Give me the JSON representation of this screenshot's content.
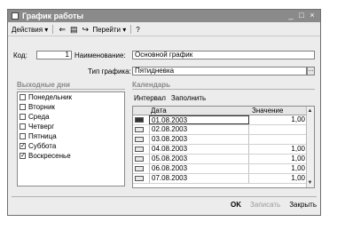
{
  "window": {
    "title": "График работы",
    "controls": [
      "_",
      "□",
      "×"
    ]
  },
  "toolbar": {
    "actions": "Действия",
    "goto": "Перейти",
    "help": "?"
  },
  "form": {
    "code_label": "Код:",
    "code_value": "1",
    "name_label": "Наименование:",
    "name_value": "Основной график",
    "type_label": "Тип графика:",
    "type_value": "Пятидневка",
    "type_button": "..."
  },
  "days": {
    "title": "Выходные дни",
    "items": [
      {
        "label": "Понедельник",
        "checked": false
      },
      {
        "label": "Вторник",
        "checked": false
      },
      {
        "label": "Среда",
        "checked": false
      },
      {
        "label": "Четверг",
        "checked": false
      },
      {
        "label": "Пятница",
        "checked": false
      },
      {
        "label": "Суббота",
        "checked": true
      },
      {
        "label": "Воскресенье",
        "checked": true
      }
    ]
  },
  "calendar": {
    "title": "Календарь",
    "interval": "Интервал",
    "fill": "Заполнить",
    "columns": {
      "date": "Дата",
      "value": "Значение"
    },
    "rows": [
      {
        "date": "01.08.2003",
        "value": "1,00"
      },
      {
        "date": "02.08.2003",
        "value": ""
      },
      {
        "date": "03.08.2003",
        "value": ""
      },
      {
        "date": "04.08.2003",
        "value": "1,00"
      },
      {
        "date": "05.08.2003",
        "value": "1,00"
      },
      {
        "date": "06.08.2003",
        "value": "1,00"
      },
      {
        "date": "07.08.2003",
        "value": "1,00"
      }
    ]
  },
  "buttons": {
    "ok": "OK",
    "save": "Записать",
    "close": "Закрыть"
  }
}
